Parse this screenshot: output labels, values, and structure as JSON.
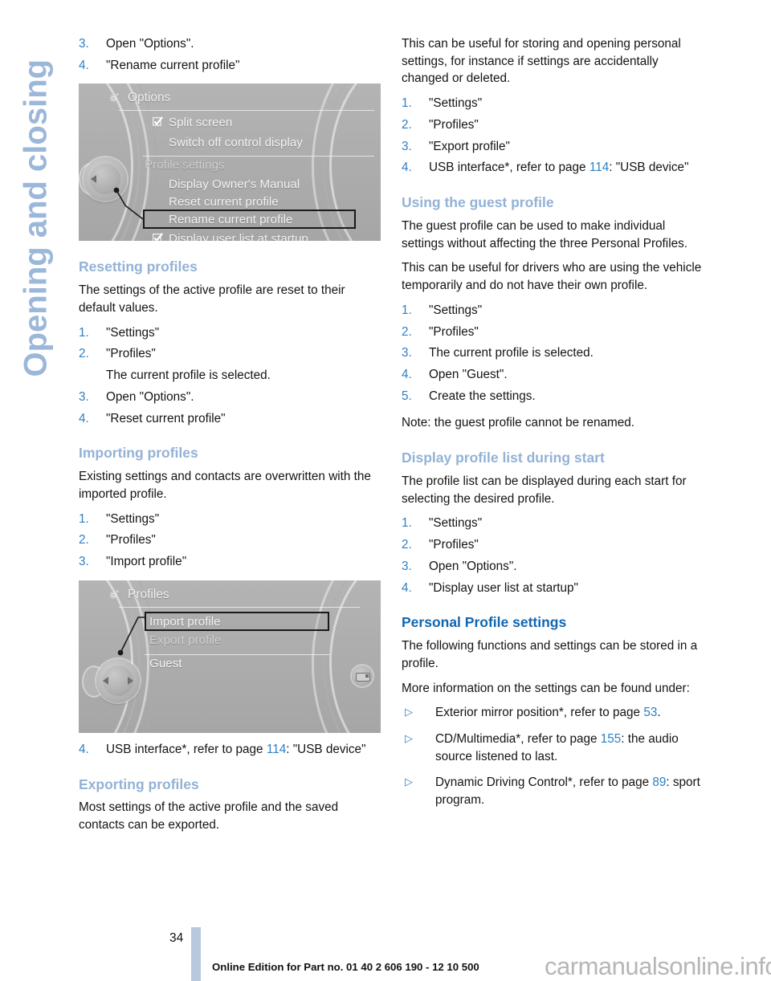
{
  "chapter_tab": {
    "label": "Opening and closing",
    "color": "#9bb7d9"
  },
  "colors": {
    "subheading_blue": "#93b2d6",
    "heading_blue": "#1266b0",
    "reference_blue": "#2d7fc4"
  },
  "left_column": {
    "top_steps": [
      {
        "num": "3.",
        "text": "Open \"Options\"."
      },
      {
        "num": "4.",
        "text": "\"Rename current profile\""
      }
    ],
    "figure_options": {
      "title": "Options",
      "icon": "gear-icon",
      "rows": [
        {
          "label": "Split screen",
          "checkbox": true,
          "style": "normal"
        },
        {
          "label": "Switch off control display",
          "checkbox": false,
          "style": "normal"
        },
        {
          "label": "Profile settings",
          "checkbox": false,
          "style": "dim"
        },
        {
          "label": "Display Owner's Manual",
          "checkbox": false,
          "style": "normal"
        },
        {
          "label": "Reset current profile",
          "checkbox": false,
          "style": "normal"
        },
        {
          "label": "Rename current profile",
          "checkbox": false,
          "style": "selected"
        },
        {
          "label": "Display user list at startup",
          "checkbox": true,
          "style": "normal"
        }
      ]
    },
    "resetting": {
      "heading": "Resetting profiles",
      "intro": "The settings of the active profile are reset to their default values.",
      "steps": [
        {
          "num": "1.",
          "text": "\"Settings\""
        },
        {
          "num": "2.",
          "text": "\"Profiles\"",
          "sub": "The current profile is selected."
        },
        {
          "num": "3.",
          "text": "Open \"Options\"."
        },
        {
          "num": "4.",
          "text": "\"Reset current profile\""
        }
      ]
    },
    "importing": {
      "heading": "Importing profiles",
      "intro": "Existing settings and contacts are overwritten with the imported profile.",
      "steps": [
        {
          "num": "1.",
          "text": "\"Settings\""
        },
        {
          "num": "2.",
          "text": "\"Profiles\""
        },
        {
          "num": "3.",
          "text": "\"Import profile\""
        }
      ]
    },
    "figure_profiles": {
      "title": "Profiles",
      "icon": "gear-icon",
      "rows": [
        {
          "label": "Import profile",
          "style": "selected"
        },
        {
          "label": "Export profile",
          "style": "dim"
        },
        {
          "label": "Guest",
          "style": "normal"
        }
      ],
      "side_icon": "split-screen-icon"
    },
    "step_after_figure": {
      "num": "4.",
      "pre": "USB interface*, refer to page ",
      "page_ref": "114",
      "post": ": \"USB device\""
    },
    "exporting": {
      "heading": "Exporting profiles",
      "intro": "Most settings of the active profile and the saved contacts can be exported."
    }
  },
  "right_column": {
    "exporting_cont": {
      "intro": "This can be useful for storing and opening personal settings, for instance if settings are accidentally changed or deleted.",
      "steps": [
        {
          "num": "1.",
          "text": "\"Settings\""
        },
        {
          "num": "2.",
          "text": "\"Profiles\""
        },
        {
          "num": "3.",
          "text": "\"Export profile\""
        }
      ],
      "step4": {
        "num": "4.",
        "pre": "USB interface*, refer to page ",
        "page_ref": "114",
        "post": ": \"USB device\""
      }
    },
    "guest_profile": {
      "heading": "Using the guest profile",
      "para1": "The guest profile can be used to make individual settings without affecting the three Personal Profiles.",
      "para2": "This can be useful for drivers who are using the vehicle temporarily and do not have their own profile.",
      "steps": [
        {
          "num": "1.",
          "text": "\"Settings\""
        },
        {
          "num": "2.",
          "text": "\"Profiles\""
        },
        {
          "num": "3.",
          "text": "The current profile is selected."
        },
        {
          "num": "4.",
          "text": "Open \"Guest\"."
        },
        {
          "num": "5.",
          "text": "Create the settings."
        }
      ],
      "note": "Note: the guest profile cannot be renamed."
    },
    "profile_list_start": {
      "heading": "Display profile list during start",
      "intro": "The profile list can be displayed during each start for selecting the desired profile.",
      "steps": [
        {
          "num": "1.",
          "text": "\"Settings\""
        },
        {
          "num": "2.",
          "text": "\"Profiles\""
        },
        {
          "num": "3.",
          "text": "Open \"Options\"."
        },
        {
          "num": "4.",
          "text": "\"Display user list at startup\""
        }
      ]
    },
    "personal_settings": {
      "heading": "Personal Profile settings",
      "para1": "The following functions and settings can be stored in a profile.",
      "para2": "More information on the settings can be found under:",
      "bullets": [
        {
          "marker": "▷",
          "pre": "Exterior mirror position*, refer to page ",
          "page_ref": "53",
          "post": "."
        },
        {
          "marker": "▷",
          "pre": "CD/Multimedia*, refer to page ",
          "page_ref": "155",
          "post": ": the audio source listened to last."
        },
        {
          "marker": "▷",
          "pre": "Dynamic Driving Control*, refer to page ",
          "page_ref": "89",
          "post": ": sport program."
        }
      ]
    }
  },
  "footer": {
    "page_number": "34",
    "edition_text": "Online Edition for Part no. 01 40 2 606 190 - 12 10 500",
    "watermark": "carmanualsonline.info"
  }
}
